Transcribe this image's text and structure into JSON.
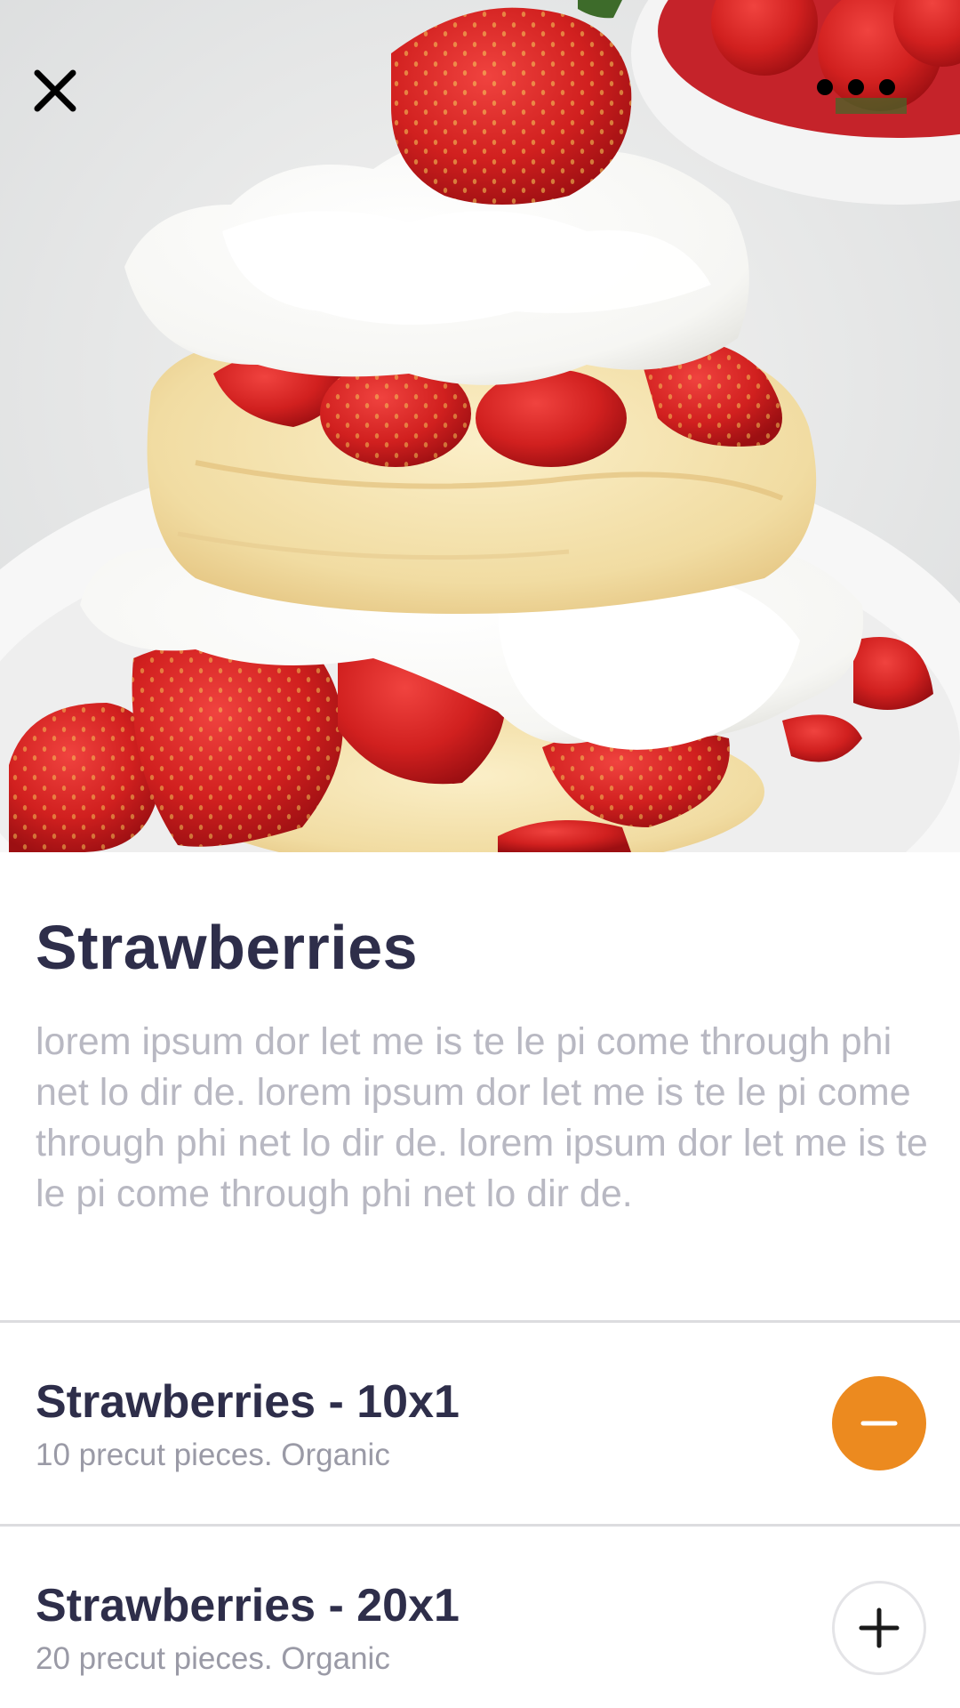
{
  "header": {
    "close_icon": "close-icon",
    "more_icon": "more-horizontal-icon"
  },
  "hero": {
    "subject": "strawberry-shortcake-photo"
  },
  "product": {
    "title": "Strawberries",
    "description": "lorem ipsum dor let me is te le pi come through phi net lo dir de. lorem ipsum dor let me is te le pi come through phi net lo dir de. lorem ipsum dor let me is te le pi come through phi net lo dir de."
  },
  "options": [
    {
      "title": "Strawberries - 10x1",
      "subtitle": "10 precut pieces. Organic",
      "selected": true,
      "action_icon": "minus-icon"
    },
    {
      "title": "Strawberries - 20x1",
      "subtitle": "20 precut pieces. Organic",
      "selected": false,
      "action_icon": "plus-icon"
    }
  ],
  "colors": {
    "accent": "#ec8a1f",
    "title_text": "#2e2e4a",
    "muted_text": "#b8b8c2",
    "divider": "#dcdcdf"
  }
}
